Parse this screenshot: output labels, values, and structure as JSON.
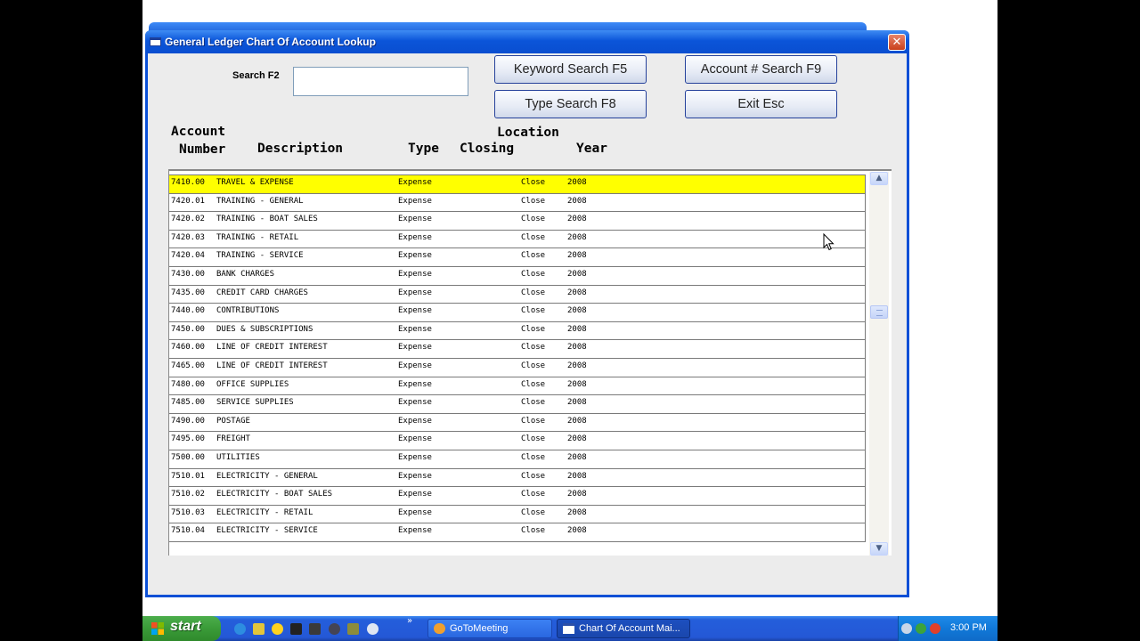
{
  "window": {
    "title": "General Ledger Chart Of Account Lookup",
    "close_glyph": "✕"
  },
  "search": {
    "label": "Search F2",
    "value": "",
    "placeholder": ""
  },
  "buttons": {
    "keyword_search": "Keyword Search  F5",
    "account_search": "Account # Search  F9",
    "type_search": "Type Search  F8",
    "exit": "Exit  Esc"
  },
  "columns": {
    "account_1": "Account",
    "account_2": "Number",
    "description": "Description",
    "type": "Type",
    "location": "Location",
    "closing": "Closing",
    "year": "Year"
  },
  "rows": [
    {
      "account": "7410.00",
      "description": "TRAVEL & EXPENSE",
      "type": "Expense",
      "closing": "Close",
      "year": "2008",
      "selected": true
    },
    {
      "account": "7420.01",
      "description": "TRAINING - GENERAL",
      "type": "Expense",
      "closing": "Close",
      "year": "2008"
    },
    {
      "account": "7420.02",
      "description": "TRAINING - BOAT SALES",
      "type": "Expense",
      "closing": "Close",
      "year": "2008"
    },
    {
      "account": "7420.03",
      "description": "TRAINING - RETAIL",
      "type": "Expense",
      "closing": "Close",
      "year": "2008"
    },
    {
      "account": "7420.04",
      "description": "TRAINING - SERVICE",
      "type": "Expense",
      "closing": "Close",
      "year": "2008"
    },
    {
      "account": "7430.00",
      "description": "BANK CHARGES",
      "type": "Expense",
      "closing": "Close",
      "year": "2008"
    },
    {
      "account": "7435.00",
      "description": "CREDIT CARD CHARGES",
      "type": "Expense",
      "closing": "Close",
      "year": "2008"
    },
    {
      "account": "7440.00",
      "description": "CONTRIBUTIONS",
      "type": "Expense",
      "closing": "Close",
      "year": "2008"
    },
    {
      "account": "7450.00",
      "description": "DUES & SUBSCRIPTIONS",
      "type": "Expense",
      "closing": "Close",
      "year": "2008"
    },
    {
      "account": "7460.00",
      "description": "LINE OF CREDIT INTEREST",
      "type": "Expense",
      "closing": "Close",
      "year": "2008"
    },
    {
      "account": "7465.00",
      "description": "LINE OF CREDIT INTEREST",
      "type": "Expense",
      "closing": "Close",
      "year": "2008"
    },
    {
      "account": "7480.00",
      "description": "OFFICE SUPPLIES",
      "type": "Expense",
      "closing": "Close",
      "year": "2008"
    },
    {
      "account": "7485.00",
      "description": "SERVICE SUPPLIES",
      "type": "Expense",
      "closing": "Close",
      "year": "2008"
    },
    {
      "account": "7490.00",
      "description": "POSTAGE",
      "type": "Expense",
      "closing": "Close",
      "year": "2008"
    },
    {
      "account": "7495.00",
      "description": "FREIGHT",
      "type": "Expense",
      "closing": "Close",
      "year": "2008"
    },
    {
      "account": "7500.00",
      "description": "UTILITIES",
      "type": "Expense",
      "closing": "Close",
      "year": "2008"
    },
    {
      "account": "7510.01",
      "description": "ELECTRICITY - GENERAL",
      "type": "Expense",
      "closing": "Close",
      "year": "2008"
    },
    {
      "account": "7510.02",
      "description": "ELECTRICITY - BOAT SALES",
      "type": "Expense",
      "closing": "Close",
      "year": "2008"
    },
    {
      "account": "7510.03",
      "description": "ELECTRICITY - RETAIL",
      "type": "Expense",
      "closing": "Close",
      "year": "2008"
    },
    {
      "account": "7510.04",
      "description": "ELECTRICITY - SERVICE",
      "type": "Expense",
      "closing": "Close",
      "year": "2008"
    }
  ],
  "scrollbar": {
    "up_glyph": "▲",
    "down_glyph": "▼",
    "position_fraction": 0.35
  },
  "taskbar": {
    "start_label": "start",
    "more_glyph": "»",
    "tasks": [
      {
        "label": "GoToMeeting",
        "active": false
      },
      {
        "label": "Chart Of Account Mai...",
        "active": true
      }
    ],
    "clock": "3:00 PM"
  },
  "colors": {
    "selected_row": "#ffff00",
    "title_bar": "#0a4fd6",
    "start_button": "#3a9b38"
  },
  "icons": {
    "window": "window-icon",
    "close": "close-icon",
    "cursor": "mouse-pointer-icon",
    "start": "windows-logo-icon"
  }
}
